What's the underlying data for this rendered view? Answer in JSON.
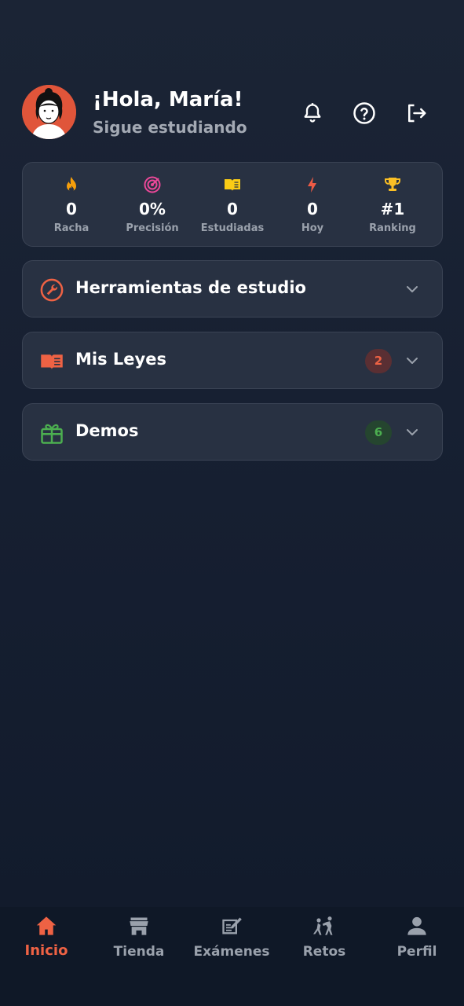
{
  "header": {
    "greeting": "¡Hola, María!",
    "subtitle": "Sigue estudiando",
    "icons": [
      "bell-icon",
      "help-icon",
      "logout-icon"
    ]
  },
  "stats": [
    {
      "value": "0",
      "label": "Racha",
      "icon": "flame-icon",
      "color": "#f59e0b"
    },
    {
      "value": "0%",
      "label": "Precisión",
      "icon": "target-icon",
      "color": "#ec4899"
    },
    {
      "value": "0",
      "label": "Estudiadas",
      "icon": "book-open-icon",
      "color": "#facc15"
    },
    {
      "value": "0",
      "label": "Hoy",
      "icon": "bolt-icon",
      "color": "#ef5b45"
    },
    {
      "value": "#1",
      "label": "Ranking",
      "icon": "trophy-icon",
      "color": "#fbbf24"
    }
  ],
  "sections": [
    {
      "title": "Herramientas de estudio",
      "icon": "wrench-icon",
      "color": "#ee6244"
    },
    {
      "title": "Mis Leyes",
      "icon": "book-icon",
      "color": "#ee6244",
      "badge": "2"
    },
    {
      "title": "Demos",
      "icon": "gift-icon",
      "color": "#4caf50",
      "badge": "6"
    }
  ],
  "nav": [
    {
      "label": "Inicio",
      "icon": "home-icon",
      "active": true
    },
    {
      "label": "Tienda",
      "icon": "store-icon"
    },
    {
      "label": "Exámenes",
      "icon": "exam-icon"
    },
    {
      "label": "Retos",
      "icon": "challenge-icon"
    },
    {
      "label": "Perfil",
      "icon": "profile-icon"
    }
  ],
  "colors": {
    "accent": "#ee6244",
    "card": "#283142",
    "background": "#172032",
    "muted": "#9aa1ac"
  }
}
